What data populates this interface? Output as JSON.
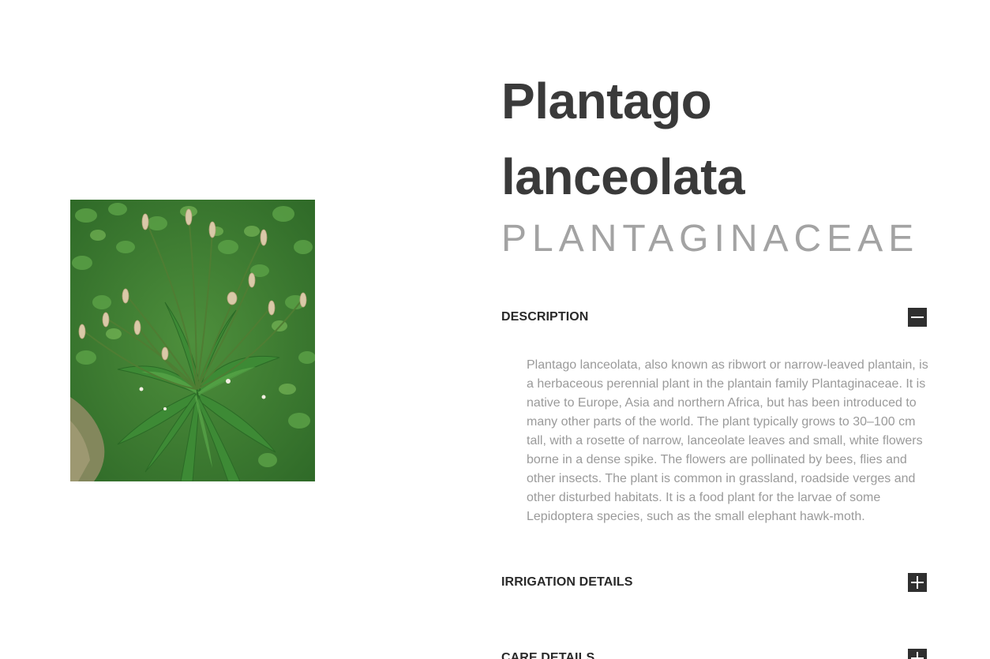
{
  "plant": {
    "name": "Plantago lanceolata",
    "family": "PLANTAGINACEAE",
    "image_alt": "Plantago lanceolata plant photo"
  },
  "sections": {
    "description": {
      "title": "DESCRIPTION",
      "expanded": true,
      "text": "Plantago lanceolata, also known as ribwort or narrow-leaved plantain, is a herbaceous perennial plant in the plantain family Plantaginaceae. It is native to Europe, Asia and northern Africa, but has been introduced to many other parts of the world. The plant typically grows to 30–100 cm tall, with a rosette of narrow, lanceolate leaves and small, white flowers borne in a dense spike. The flowers are pollinated by bees, flies and other insects. The plant is common in grassland, roadside verges and other disturbed habitats. It is a food plant for the larvae of some Lepidoptera species, such as the small elephant hawk-moth."
    },
    "irrigation": {
      "title": "IRRIGATION DETAILS",
      "expanded": false
    },
    "care": {
      "title": "CARE DETAILS",
      "expanded": false
    }
  },
  "icons": {
    "collapse": "minus-icon",
    "expand": "plus-icon"
  },
  "colors": {
    "title": "#3a3a3a",
    "family": "#a3a3a3",
    "body_text": "#9a9a9a",
    "toggle_bg": "#2f2f2f"
  }
}
